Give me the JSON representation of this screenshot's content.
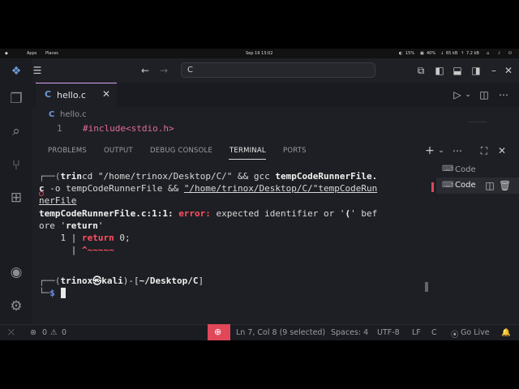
{
  "system_bar": {
    "apps": "Apps",
    "places": "Places",
    "clock": "Sep 19  13:02",
    "battery": "15%",
    "cpu": "40%",
    "net_down": "65 kB",
    "net_up": "7.2 kB"
  },
  "titlebar": {
    "command_center": "C"
  },
  "editor": {
    "tab_icon": "C",
    "tab_label": "hello.c",
    "tab_close": "✕",
    "breadcrumb_icon": "C",
    "breadcrumb": "hello.c",
    "line_number": "1",
    "code_line": "#include<stdio.h>"
  },
  "panel": {
    "tabs": [
      "PROBLEMS",
      "OUTPUT",
      "DEBUG CONSOLE",
      "TERMINAL",
      "PORTS"
    ],
    "active_tab": "TERMINAL",
    "terminals": [
      "Code",
      "Code"
    ]
  },
  "terminal": {
    "line1_prefix": "┌──(",
    "line1_user": "trin",
    "line1_cmd": "cd \"/home/trinox/Desktop/C/\" && gcc ",
    "line1_file": "tempCodeRunnerFile.",
    "line2_a": "c",
    "line2_b": " -o tempCodeRunnerFile && ",
    "line2_link": "\"/home/trinox/Desktop/C/\"tempCodeRun",
    "line3_link": "nerFile",
    "line4_loc": "tempCodeRunnerFile.c:1:1: ",
    "line4_err": "error:",
    "line4_msg": " expected identifier or '",
    "line4_paren": "(",
    "line4_end": "' bef",
    "line5_a": "ore '",
    "line5_kw": "return",
    "line5_b": "'",
    "line6_num": "    1 | ",
    "line6_code": "return",
    "line6_rest": " 0;",
    "line7_bar": "      | ",
    "line7_caret": "^~~~~~",
    "prompt_top": "┌──(",
    "prompt_user": "trinox㉿kali",
    "prompt_mid": ")-[",
    "prompt_path": "~/Desktop/C",
    "prompt_close": "]",
    "prompt_bottom": "└─",
    "prompt_dollar": "$"
  },
  "status_bar": {
    "errors": "0",
    "warnings": "0",
    "position": "Ln 7, Col 8 (9 selected)",
    "spaces": "Spaces: 4",
    "encoding": "UTF-8",
    "eol": "LF",
    "language": "C",
    "go_live": "Go Live"
  },
  "colors": {
    "accent": "#d6a3f7",
    "error": "#e0485a",
    "link_blue": "#6a8ee6"
  }
}
